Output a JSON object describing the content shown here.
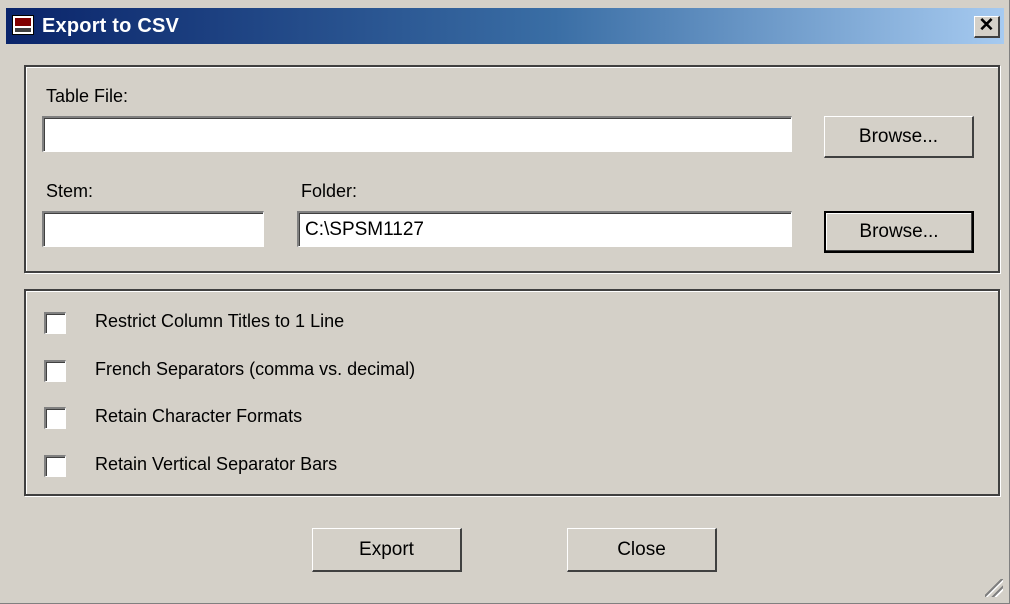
{
  "window": {
    "title": "Export to CSV",
    "close_glyph": "✕"
  },
  "file_group": {
    "table_file_label": "Table File:",
    "table_file_value": "",
    "browse_label": "Browse...",
    "stem_label": "Stem:",
    "stem_value": "",
    "folder_label": "Folder:",
    "folder_value": "C:\\SPSM1127",
    "browse2_label": "Browse..."
  },
  "options": [
    {
      "label": "Restrict Column Titles to 1 Line",
      "checked": false
    },
    {
      "label": "French Separators (comma vs. decimal)",
      "checked": false
    },
    {
      "label": "Retain Character Formats",
      "checked": false
    },
    {
      "label": "Retain Vertical Separator Bars",
      "checked": false
    }
  ],
  "actions": {
    "export_label": "Export",
    "close_label": "Close"
  },
  "colors": {
    "face": "#d4d0c8",
    "title_start": "#0a246a",
    "title_end": "#a6caf0"
  }
}
